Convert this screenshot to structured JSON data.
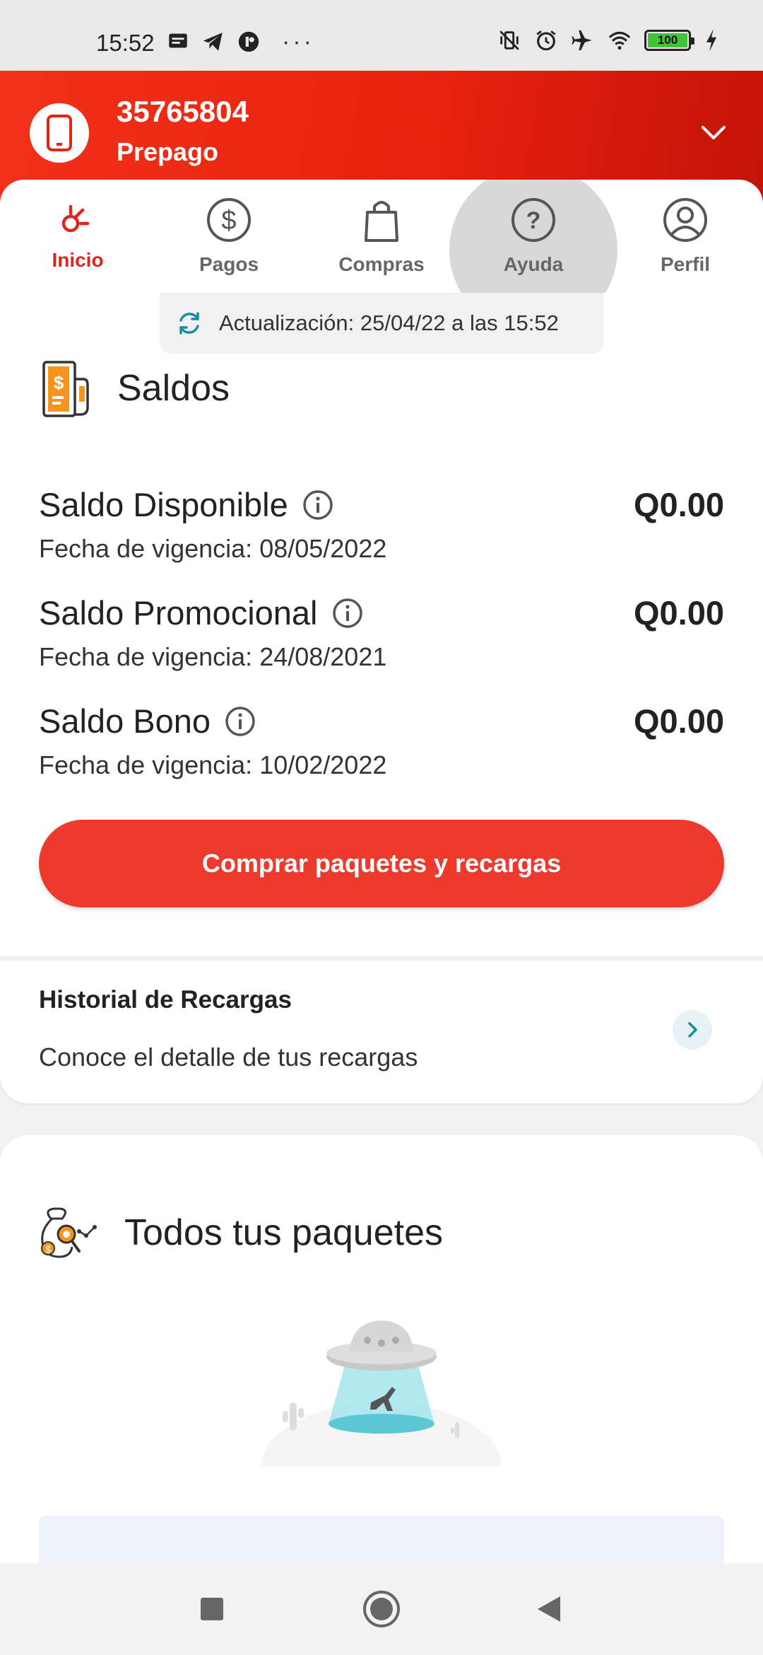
{
  "status_bar": {
    "time": "15:52",
    "battery": "100"
  },
  "header": {
    "phone_number": "35765804",
    "plan": "Prepago"
  },
  "tabs": [
    {
      "label": "Inicio",
      "active": true
    },
    {
      "label": "Pagos",
      "active": false
    },
    {
      "label": "Compras",
      "active": false
    },
    {
      "label": "Ayuda",
      "active": false
    },
    {
      "label": "Perfil",
      "active": false
    }
  ],
  "saldos": {
    "update_text": "Actualización: 25/04/22 a las 15:52",
    "title": "Saldos",
    "balances": [
      {
        "name": "Saldo Disponible",
        "date": "Fecha de vigencia: 08/05/2022",
        "amount": "Q0.00"
      },
      {
        "name": "Saldo Promocional",
        "date": "Fecha de vigencia: 24/08/2021",
        "amount": "Q0.00"
      },
      {
        "name": "Saldo Bono",
        "date": "Fecha de vigencia: 10/02/2022",
        "amount": "Q0.00"
      }
    ],
    "buy_button": "Comprar paquetes y recargas"
  },
  "history": {
    "title": "Historial de Recargas",
    "subtitle": "Conoce el detalle de tus recargas"
  },
  "packages": {
    "title": "Todos tus paquetes"
  },
  "colors": {
    "brand_red": "#e8220f",
    "button_red": "#ee3a2c",
    "active_tab": "#e0261a",
    "accent_teal": "#1a8ea0"
  }
}
